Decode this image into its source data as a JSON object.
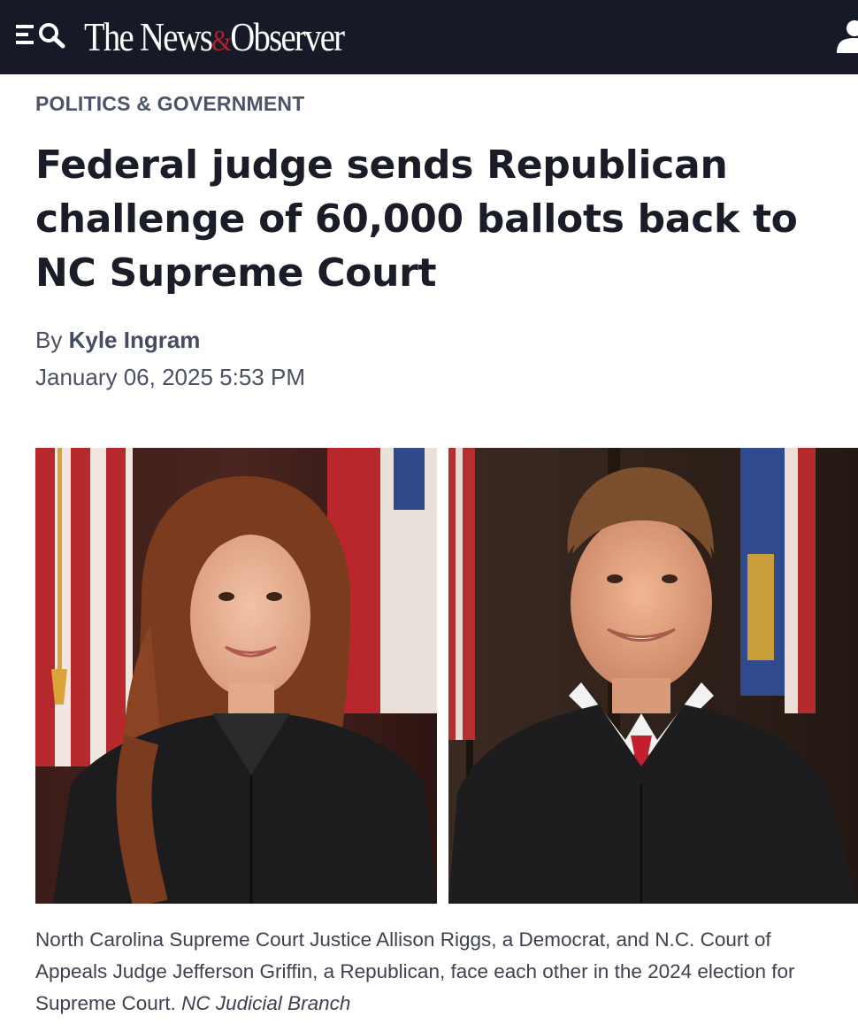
{
  "header": {
    "logo_text_1": "The News",
    "logo_amp": "&",
    "logo_text_2": "Observer",
    "menu_icon": "menu-search-icon",
    "user_icon": "user-icon",
    "colors": {
      "background": "#161a26",
      "amp": "#b3202a"
    }
  },
  "article": {
    "section": "POLITICS & GOVERNMENT",
    "headline": "Federal judge sends Republican challenge of 60,000 ballots back to NC Supreme Court",
    "byline_prefix": "By",
    "author": "Kyle Ingram",
    "date": "January 06, 2025 5:53 PM",
    "caption": "North Carolina Supreme Court Justice Allison Riggs, a Democrat, and N.C. Court of Appeals Judge Jefferson Griffin, a Republican, face each other in the 2024 election for Supreme Court.",
    "credit": "NC Judicial Branch"
  }
}
